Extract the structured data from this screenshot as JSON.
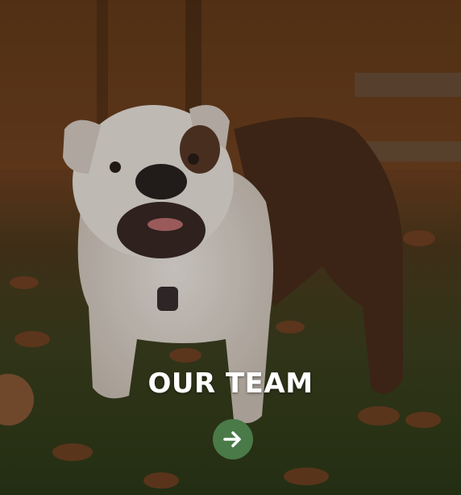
{
  "section": {
    "title": "OUR TEAM",
    "button_icon": "arrow-right-icon",
    "button_color": "#4a7a47",
    "image_description_icon": "bulldog-photo"
  }
}
